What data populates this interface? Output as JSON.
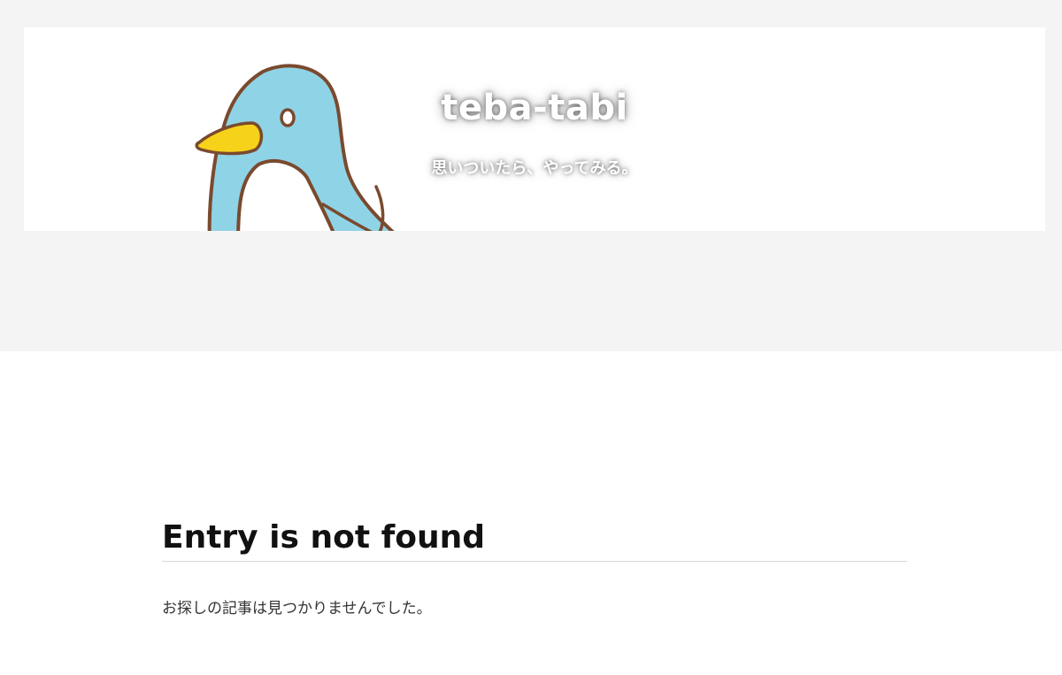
{
  "header": {
    "title": "teba-tabi",
    "tagline": "思いついたら、やってみる。",
    "mascot_icon": "penguin-mascot-icon"
  },
  "main": {
    "heading": "Entry is not found",
    "message": "お探しの記事は見つかりませんでした。"
  },
  "colors": {
    "page_band": "#f4f4f4",
    "card": "#ffffff",
    "penguin_body": "#8fd3e6",
    "penguin_outline": "#7a4a2e",
    "beak": "#f6d21a",
    "heading_text": "#111111",
    "body_text": "#333333"
  }
}
